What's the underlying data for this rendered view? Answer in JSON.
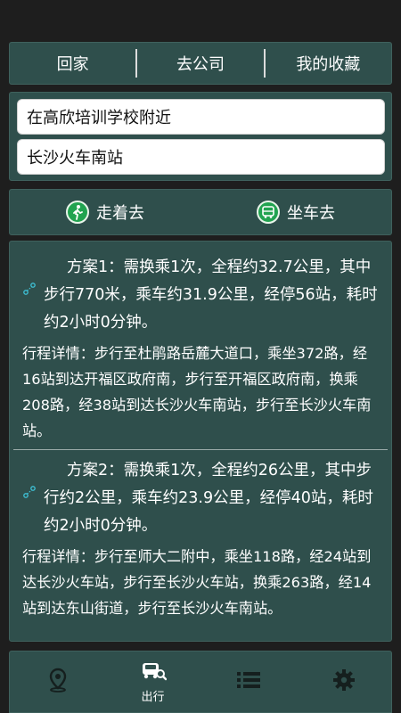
{
  "quick_nav": {
    "home": "回家",
    "office": "去公司",
    "favorites": "我的收藏"
  },
  "route": {
    "from": "在高欣培训学校附近",
    "to": "长沙火车南站"
  },
  "modes": {
    "walk": "走着去",
    "bus": "坐车去"
  },
  "plans": [
    {
      "summary": "方案1：需换乘1次，全程约32.7公里，其中步行770米，乘车约31.9公里，经停56站，耗时约2小时0分钟。",
      "detail": "行程详情：步行至杜鹃路岳麓大道口，乘坐372路，经16站到达开福区政府南，步行至开福区政府南，换乘208路，经38站到达长沙火车南站，步行至长沙火车南站。"
    },
    {
      "summary": "方案2：需换乘1次，全程约26公里，其中步行约2公里，乘车约23.9公里，经停40站，耗时约2小时0分钟。",
      "detail": "行程详情：步行至师大二附中，乘坐118路，经24站到达长沙火车站，步行至长沙火车站，换乘263路，经14站到达东山街道，步行至长沙火车南站。"
    }
  ],
  "bottom_nav": {
    "travel": "出行"
  },
  "colors": {
    "panel": "#2f4f4c",
    "background": "#1e1e1e",
    "accent_green": "#21a350",
    "link_icon": "#3ec1d6"
  }
}
